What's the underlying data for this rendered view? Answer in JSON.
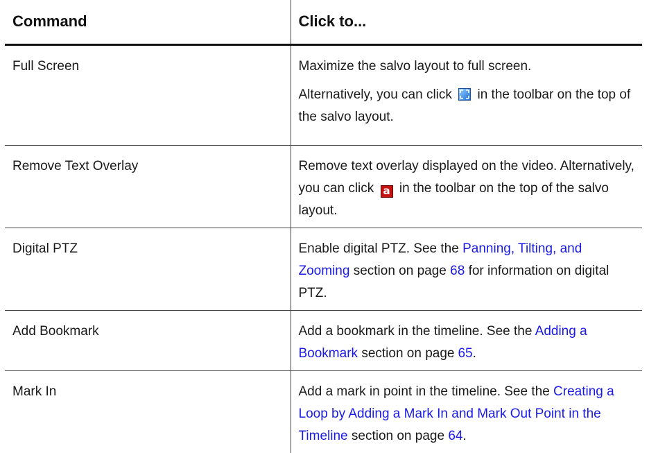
{
  "header": {
    "command": "Command",
    "action": "Click to..."
  },
  "rows": [
    {
      "command": "Full Screen",
      "p1": "Maximize the salvo layout to full screen.",
      "p2_before": "Alternatively, you can click",
      "p2_after": "in the toolbar on the top of the salvo layout.",
      "icon": "full-screen-icon"
    },
    {
      "command": "Remove Text Overlay",
      "line1": "Remove text overlay displayed on the video.",
      "before": "Alternatively, you can click",
      "after": "in the toolbar on the top of the salvo layout.",
      "icon": "text-overlay-icon",
      "icon_glyph": "a"
    },
    {
      "command": "Digital PTZ",
      "before": "Enable digital PTZ. See the",
      "link": "Panning, Tilting, and Zooming",
      "mid": "section on page",
      "page": "68",
      "after": "for information on digital PTZ."
    },
    {
      "command": "Add Bookmark",
      "before": "Add a bookmark in the timeline. See the",
      "link": "Adding a Bookmark",
      "mid": "section on page",
      "page": "65",
      "after": "."
    },
    {
      "command": "Mark In",
      "before": "Add a mark in point in the timeline. See the",
      "link": "Creating a Loop by Adding a Mark In and Mark Out Point in the Timeline",
      "mid": "section on page",
      "page": "64",
      "after": "."
    }
  ],
  "colors": {
    "link": "#1a1ae6",
    "text": "#1a1a1a",
    "rule": "#444444"
  }
}
